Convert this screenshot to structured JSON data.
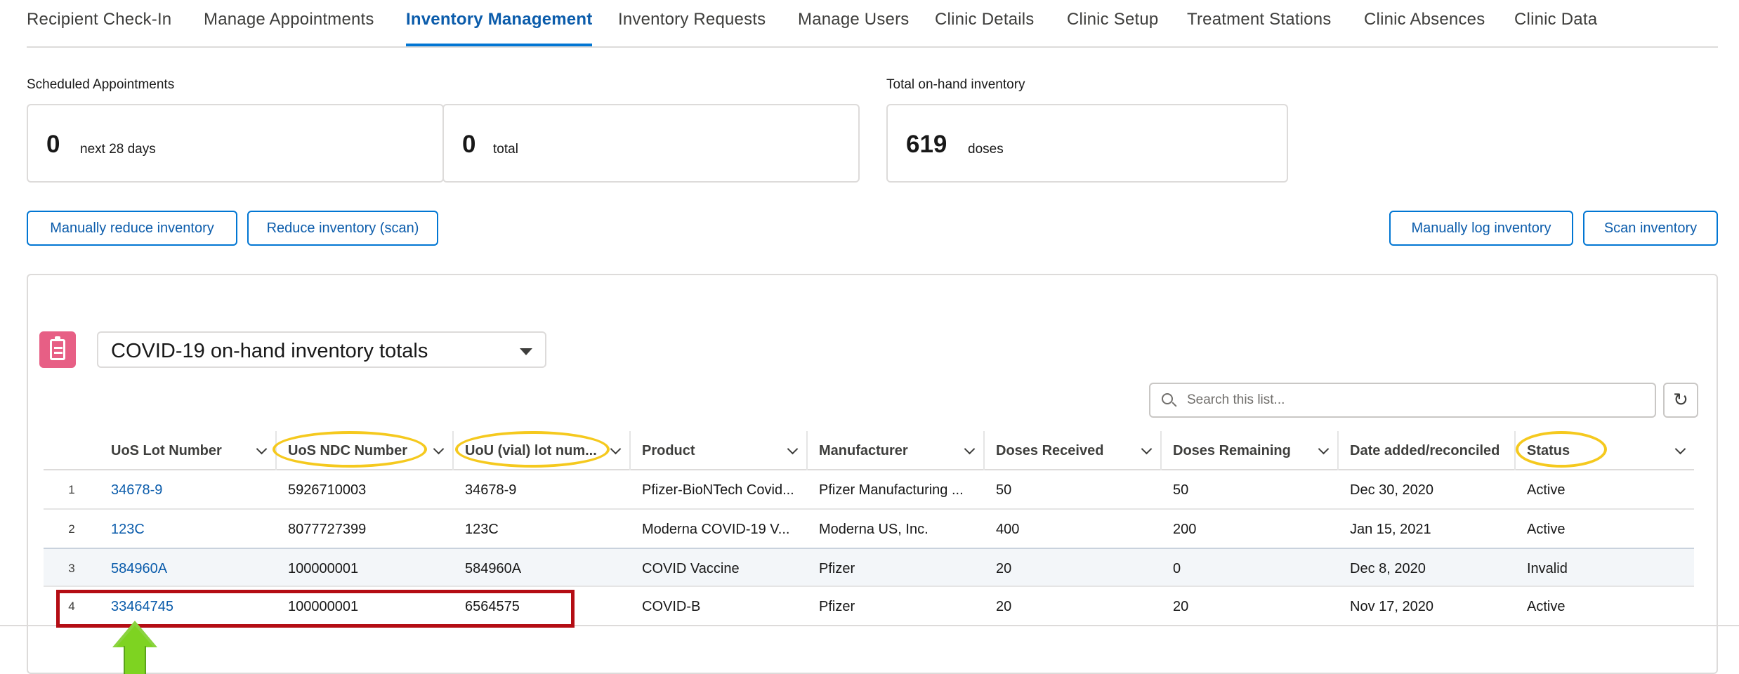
{
  "tabs": [
    {
      "label": "Recipient Check-In"
    },
    {
      "label": "Manage Appointments"
    },
    {
      "label": "Inventory Management"
    },
    {
      "label": "Inventory Requests"
    },
    {
      "label": "Manage Users"
    },
    {
      "label": "Clinic Details"
    },
    {
      "label": "Clinic Setup"
    },
    {
      "label": "Treatment Stations"
    },
    {
      "label": "Clinic Absences"
    },
    {
      "label": "Clinic Data"
    }
  ],
  "active_tab": "Inventory Management",
  "appointments": {
    "label": "Scheduled Appointments",
    "next": {
      "value": "0",
      "unit": "next 28 days"
    },
    "total": {
      "value": "0",
      "unit": "total"
    }
  },
  "inventory": {
    "label": "Total on-hand inventory",
    "value": "619",
    "unit": "doses"
  },
  "buttons": {
    "manual_reduce": "Manually reduce inventory",
    "reduce_scan": "Reduce inventory (scan)",
    "manual_log": "Manually log inventory",
    "scan": "Scan inventory"
  },
  "list_view": {
    "selected": "COVID-19 on-hand inventory totals",
    "search_placeholder": "Search this list...",
    "icon": "clipboard-list-icon"
  },
  "table": {
    "columns": [
      "UoS Lot Number",
      "UoS NDC Number",
      "UoU (vial) lot num...",
      "Product",
      "Manufacturer",
      "Doses Received",
      "Doses Remaining",
      "Date added/reconciled",
      "Status"
    ],
    "rows": [
      {
        "n": "1",
        "lot": "34678-9",
        "ndc": "5926710003",
        "vial": "34678-9",
        "product": "Pfizer-BioNTech Covid...",
        "manufacturer": "Pfizer Manufacturing ...",
        "received": "50",
        "remaining": "50",
        "date": "Dec 30, 2020",
        "status": "Active"
      },
      {
        "n": "2",
        "lot": "123C",
        "ndc": "8077727399",
        "vial": "123C",
        "product": "Moderna COVID-19 V...",
        "manufacturer": "Moderna US, Inc.",
        "received": "400",
        "remaining": "200",
        "date": "Jan 15, 2021",
        "status": "Active"
      },
      {
        "n": "3",
        "lot": "584960A",
        "ndc": "100000001",
        "vial": "584960A",
        "product": "COVID Vaccine",
        "manufacturer": "Pfizer",
        "received": "20",
        "remaining": "0",
        "date": "Dec 8, 2020",
        "status": "Invalid"
      },
      {
        "n": "4",
        "lot": "33464745",
        "ndc": "100000001",
        "vial": "6564575",
        "product": "COVID-B",
        "manufacturer": "Pfizer",
        "received": "20",
        "remaining": "20",
        "date": "Nov 17, 2020",
        "status": "Active"
      }
    ]
  },
  "annotation_colors": {
    "highlight_oval": "#f5c91e",
    "red_box": "#b40d14",
    "arrow": "#7ed321"
  }
}
